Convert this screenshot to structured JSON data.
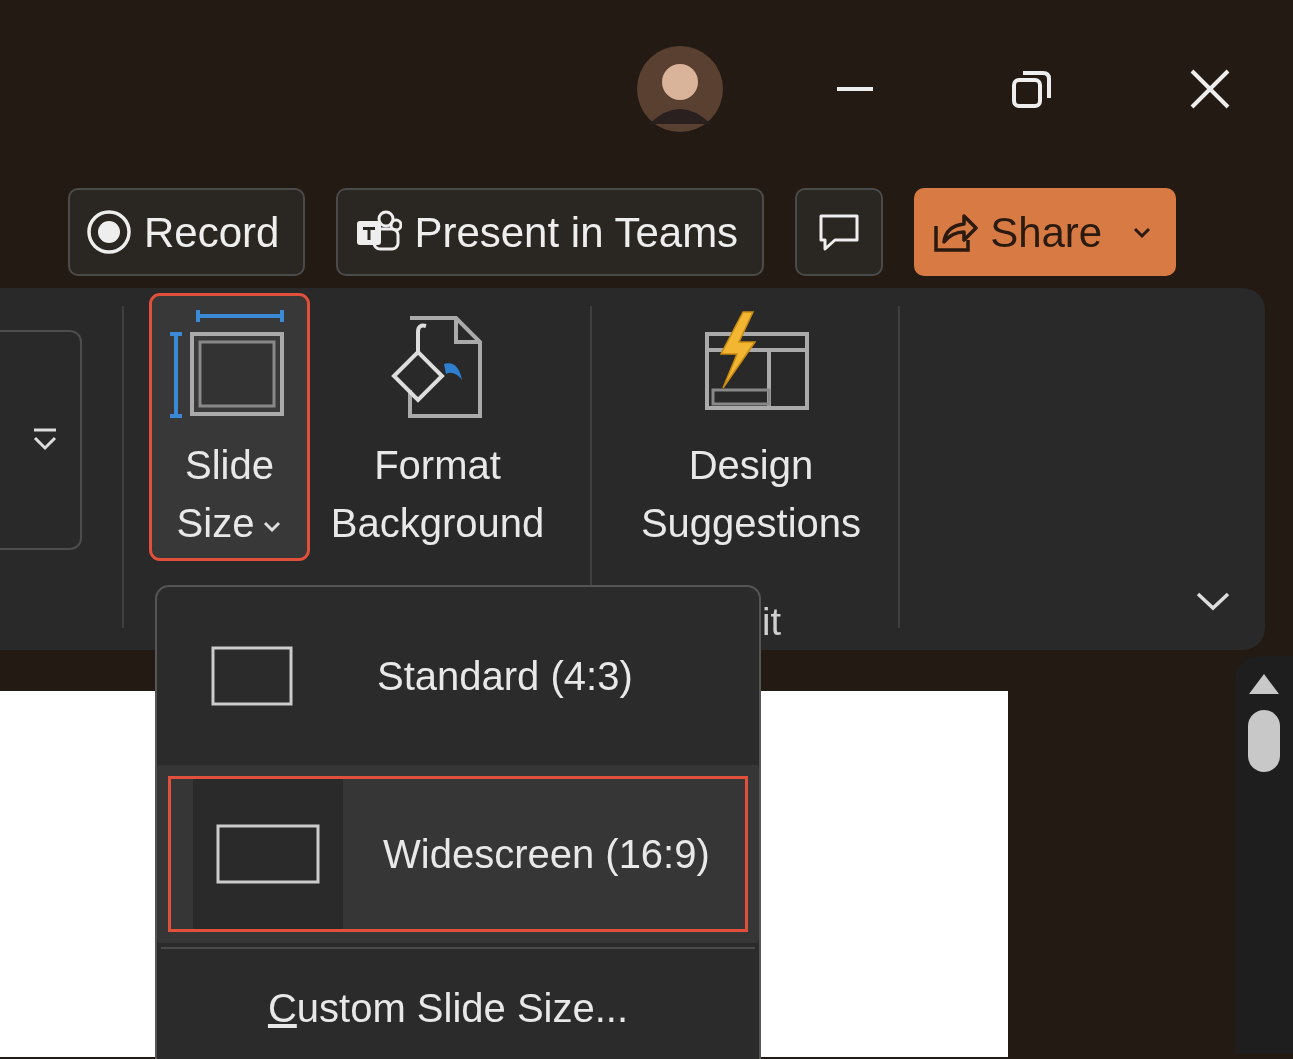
{
  "actions": [
    {
      "kind": "record",
      "label": "Record"
    },
    {
      "kind": "teams",
      "label": "Present in Teams"
    },
    {
      "kind": "comment"
    },
    {
      "kind": "share",
      "label": "Share",
      "has_dropdown": true
    }
  ],
  "ribbon": {
    "commands": [
      {
        "kind": "slide-size",
        "label": "Slide Size",
        "has_dropdown": true,
        "expanded": true,
        "annotated": true
      },
      {
        "kind": "format-background",
        "label": "Format Background",
        "has_dropdown": false,
        "expanded": false,
        "annotated": false
      },
      {
        "kind": "designer",
        "label": "Design Suggestions",
        "has_dropdown": false,
        "expanded": false,
        "annotated": false
      }
    ],
    "group_label": "it"
  },
  "menu": {
    "items": [
      {
        "kind": "standard-ratio",
        "label": "Standard (4:3)",
        "selected": false,
        "annotated": false
      },
      {
        "kind": "wide-ratio",
        "label": "Widescreen (16:9)",
        "selected": true,
        "annotated": true
      },
      {
        "kind": "action",
        "label": "Custom Slide Size...",
        "access_key_underlined": true
      }
    ]
  }
}
